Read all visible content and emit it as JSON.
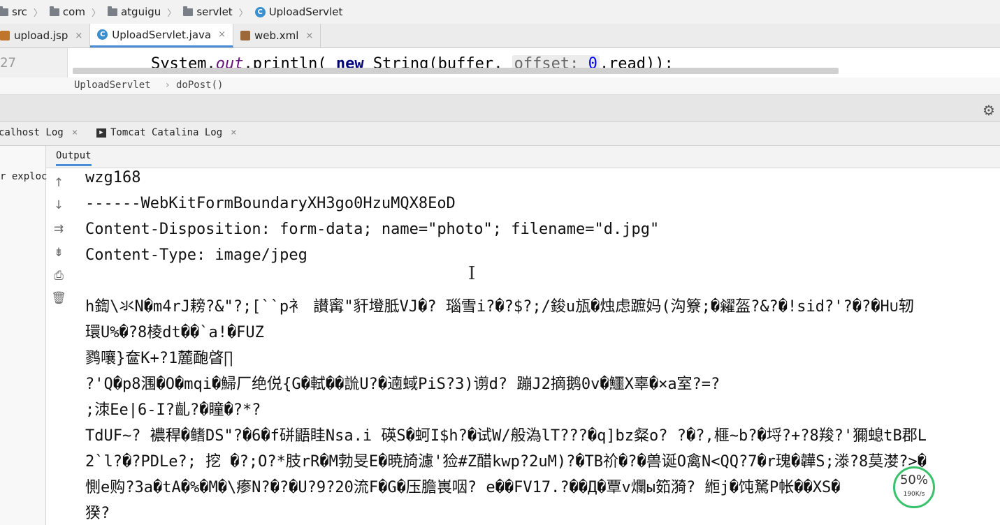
{
  "breadcrumb": [
    "src",
    "com",
    "atguigu",
    "servlet",
    "UploadServlet"
  ],
  "editor_tabs": [
    {
      "label": "upload.jsp",
      "icon": "jsp-file-icon"
    },
    {
      "label": "UploadServlet.java",
      "icon": "java-class-icon",
      "active": true
    },
    {
      "label": "web.xml",
      "icon": "xml-file-icon"
    }
  ],
  "tab_close": "×",
  "code": {
    "line_number": "27",
    "pre": "System.",
    "out": "out",
    "mid": ".println( ",
    "kw_new": "new",
    "mid2": " String(buffer, ",
    "hint": "offset: ",
    "num": "0",
    "post": ",read));"
  },
  "method_breadcrumb": [
    "UploadServlet",
    "doPost()"
  ],
  "log_tabs": [
    {
      "label": "calhost Log"
    },
    {
      "label": "Tomcat Catalina Log"
    }
  ],
  "output_label": "Output",
  "left_panel_text": "r exploc",
  "console_tools": [
    "up-arrow-icon",
    "down-arrow-icon",
    "soft-wrap-icon",
    "scroll-to-end-icon",
    "print-icon",
    "clear-trash-icon"
  ],
  "output_lines": [
    "wzg168",
    "------WebKitFormBoundaryXH3go0HzuMQX8EoD",
    "Content-Disposition: form-data; name=\"photo\"; filename=\"d.jpg\"",
    "Content-Type: image/jpeg",
    "",
    "h鍧\\氺N�m4rJ耪?&\"?;[``p衤 讃寗\"豻墱胝VJ�? 瑙雪i?�?$?;/鋑u瓬�烛虑蹠妈(沟簝;�糴盔?&?�!sid?'?�?�H∪轫",
    "環U%�?8棱dt��`a!�FUZ",
    "鹨嚷}奩K+?1麓靤晵∏",
    "?'Q�p8涠�O�mqi�鯞厂绝侻{G�軾��詤U?�遖蜮PiS?3)谫d? 蹦J2摘鹅0v�鱷X辜�×a室?=?",
    " ;洓Ee|6-I?齓?�瞳�?*?",
    "TdUF~? 襛稈�鳍DS\"?�6�f硑鼯眭Nsa.i 碤S�蚵I$h?�试W/般溈lT???�q]bz粲o? ?�?,榧~b?�埒?+?8羧?'獮螅tB郡L",
    "2`l?�?PDLe?; 挖 �?;O?*肢rR�M勃旻E�暁旑濾'猃#Z醋kwp?2uM)?�TB祄�?�兽诞O禽N<QQ?7�r瑰�韡S;漛?8莫漤?>�",
    "惻e购?3a�tA�%�M�\\瘆N?�?�U?9?20流F�G�压膽嵔咽? e��FV17.?��Д�覃v爛ы筎漪? 縆j�饨駑P帐��XS�",
    "猤?"
  ],
  "speed": {
    "percent": "50%",
    "rate": "190K/s"
  }
}
